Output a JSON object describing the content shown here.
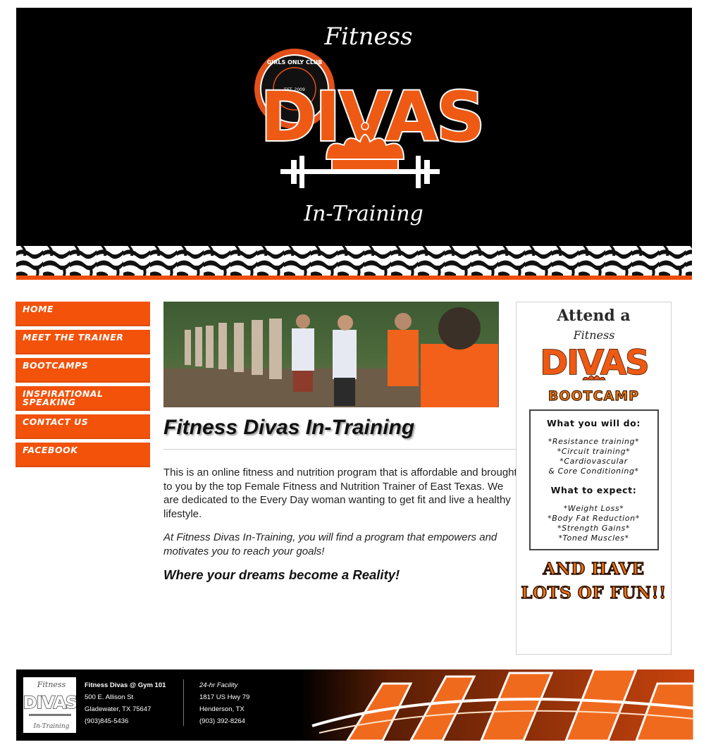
{
  "header": {
    "logo": {
      "top_script": "Fitness",
      "main_word": "DIVAS",
      "bottom_script": "In-Training",
      "seal_text": "GIRLS ONLY CLUB",
      "seal_est": "EST. 2009"
    }
  },
  "nav": {
    "items": [
      {
        "label": "HOME"
      },
      {
        "label": "MEET THE TRAINER"
      },
      {
        "label": "BOOTCAMPS"
      },
      {
        "label": "INSPIRATIONAL SPEAKING"
      },
      {
        "label": "CONTACT US"
      },
      {
        "label": "FACEBOOK"
      }
    ]
  },
  "main": {
    "title": "Fitness Divas In-Training",
    "paragraph1": "This is an online fitness and nutrition program that is affordable and brought to you by the top Female Fitness and Nutrition Trainer of East Texas. We are dedicated to the Every Day woman wanting to get fit and live a healthy lifestyle.",
    "paragraph2": "At Fitness Divas In-Training, you will find a program that empowers and motivates you to reach your goals!",
    "tagline": "Where your dreams become a Reality!"
  },
  "sidebar": {
    "attend": "Attend a",
    "logo_script": "Fitness",
    "logo_word": "DIVAS",
    "bootcamp": "BOOTCAMP",
    "what_you_will_do": "What you will do:",
    "activities": [
      "*Resistance training*",
      "*Circuit training*",
      "*Cardiovascular",
      "& Core Conditioning*"
    ],
    "what_to_expect": "What to expect:",
    "expectations": [
      "*Weight Loss*",
      "*Body Fat Reduction*",
      "*Strength Gains*",
      "*Toned Muscles*"
    ],
    "fun_line1": "AND HAVE",
    "fun_line2": "LOTS OF FUN!!"
  },
  "footer": {
    "logo": {
      "script": "Fitness",
      "word": "DIVAS",
      "bottom": "In-Training"
    },
    "location1": {
      "title": "Fitness Divas @ Gym 101",
      "street": "500 E. Allison St",
      "city": "Gladewater, TX 75647",
      "phone": "(903)845-5436"
    },
    "location2": {
      "title": "24-hr Facility",
      "street": "1817 US Hwy 79",
      "city": "Henderson, TX",
      "phone": "(903) 392-8264"
    }
  },
  "colors": {
    "brand_orange": "#f2520a",
    "header_bg": "#000000",
    "footer_bg": "#000000"
  }
}
